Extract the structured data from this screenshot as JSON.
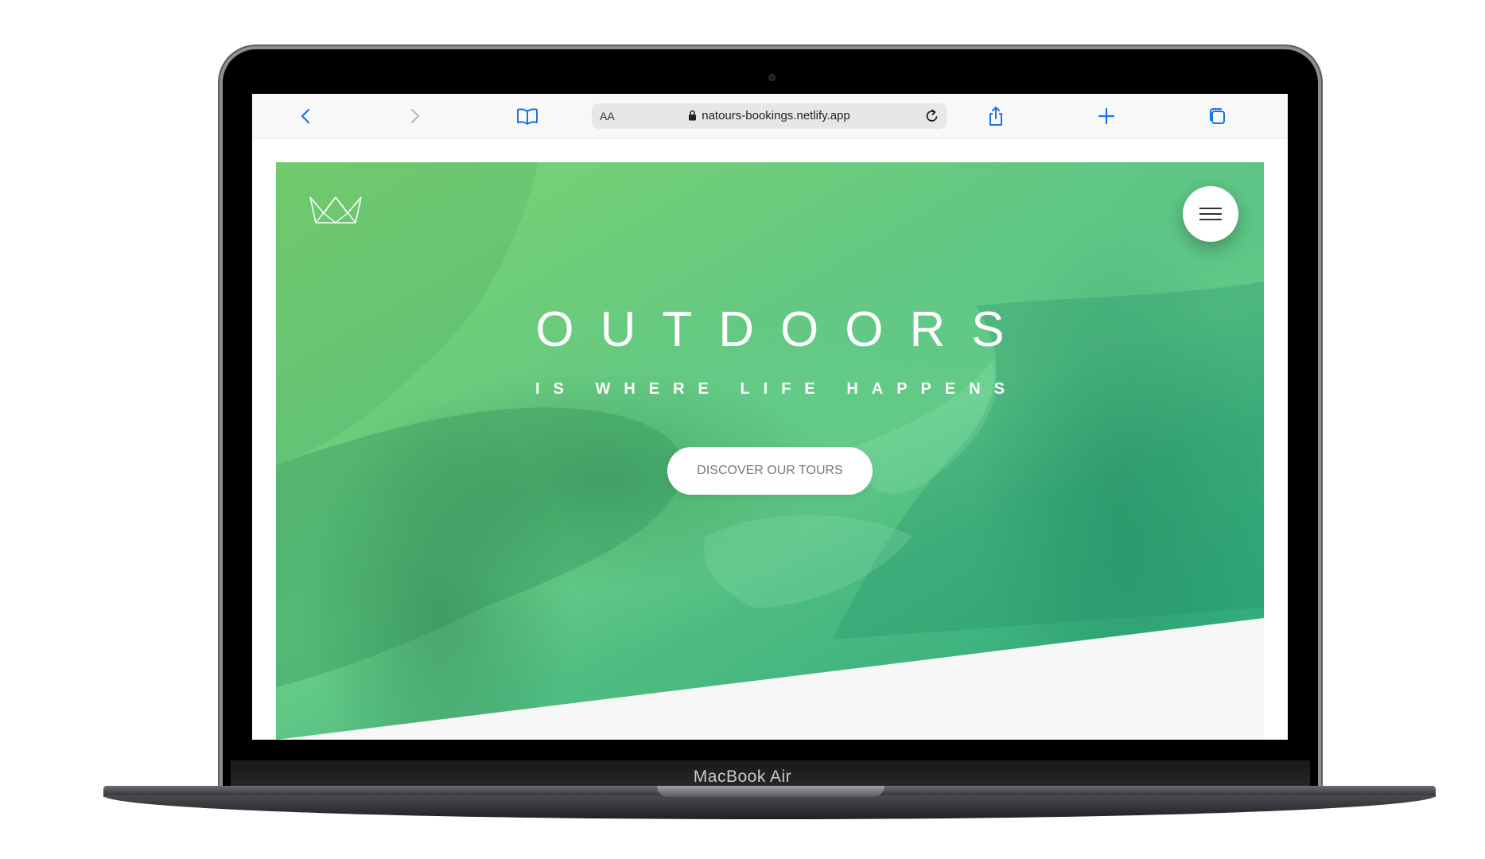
{
  "device": {
    "model_label": "MacBook Air"
  },
  "browser": {
    "reader_label": "AA",
    "url": "natours-bookings.netlify.app",
    "accent_color": "#1a73e8"
  },
  "hero": {
    "heading_main": "OUTDOORS",
    "heading_sub": "IS WHERE LIFE HAPPENS",
    "cta_label": "DISCOVER OUR TOURS",
    "gradient_colors": [
      "#7ed56f",
      "#28b485"
    ]
  },
  "icons": {
    "back": "chevron-left-icon",
    "forward": "chevron-right-icon",
    "bookmarks": "book-icon",
    "lock": "lock-icon",
    "reload": "reload-icon",
    "share": "share-icon",
    "new_tab": "plus-icon",
    "tabs": "tabs-icon",
    "logo": "crown-logo",
    "menu": "hamburger-icon"
  }
}
